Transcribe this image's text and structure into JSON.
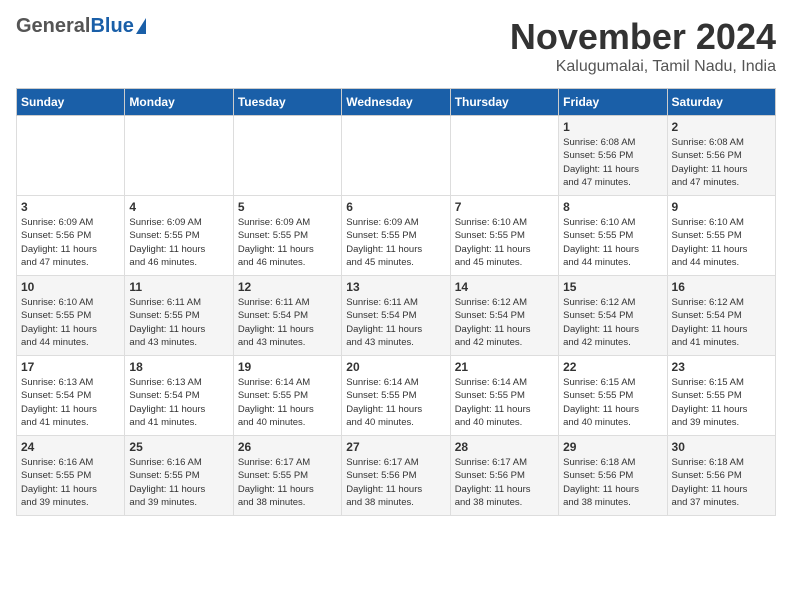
{
  "header": {
    "logo_general": "General",
    "logo_blue": "Blue",
    "month": "November 2024",
    "location": "Kalugumalai, Tamil Nadu, India"
  },
  "weekdays": [
    "Sunday",
    "Monday",
    "Tuesday",
    "Wednesday",
    "Thursday",
    "Friday",
    "Saturday"
  ],
  "weeks": [
    [
      {
        "day": "",
        "info": ""
      },
      {
        "day": "",
        "info": ""
      },
      {
        "day": "",
        "info": ""
      },
      {
        "day": "",
        "info": ""
      },
      {
        "day": "",
        "info": ""
      },
      {
        "day": "1",
        "info": "Sunrise: 6:08 AM\nSunset: 5:56 PM\nDaylight: 11 hours\nand 47 minutes."
      },
      {
        "day": "2",
        "info": "Sunrise: 6:08 AM\nSunset: 5:56 PM\nDaylight: 11 hours\nand 47 minutes."
      }
    ],
    [
      {
        "day": "3",
        "info": "Sunrise: 6:09 AM\nSunset: 5:56 PM\nDaylight: 11 hours\nand 47 minutes."
      },
      {
        "day": "4",
        "info": "Sunrise: 6:09 AM\nSunset: 5:55 PM\nDaylight: 11 hours\nand 46 minutes."
      },
      {
        "day": "5",
        "info": "Sunrise: 6:09 AM\nSunset: 5:55 PM\nDaylight: 11 hours\nand 46 minutes."
      },
      {
        "day": "6",
        "info": "Sunrise: 6:09 AM\nSunset: 5:55 PM\nDaylight: 11 hours\nand 45 minutes."
      },
      {
        "day": "7",
        "info": "Sunrise: 6:10 AM\nSunset: 5:55 PM\nDaylight: 11 hours\nand 45 minutes."
      },
      {
        "day": "8",
        "info": "Sunrise: 6:10 AM\nSunset: 5:55 PM\nDaylight: 11 hours\nand 44 minutes."
      },
      {
        "day": "9",
        "info": "Sunrise: 6:10 AM\nSunset: 5:55 PM\nDaylight: 11 hours\nand 44 minutes."
      }
    ],
    [
      {
        "day": "10",
        "info": "Sunrise: 6:10 AM\nSunset: 5:55 PM\nDaylight: 11 hours\nand 44 minutes."
      },
      {
        "day": "11",
        "info": "Sunrise: 6:11 AM\nSunset: 5:55 PM\nDaylight: 11 hours\nand 43 minutes."
      },
      {
        "day": "12",
        "info": "Sunrise: 6:11 AM\nSunset: 5:54 PM\nDaylight: 11 hours\nand 43 minutes."
      },
      {
        "day": "13",
        "info": "Sunrise: 6:11 AM\nSunset: 5:54 PM\nDaylight: 11 hours\nand 43 minutes."
      },
      {
        "day": "14",
        "info": "Sunrise: 6:12 AM\nSunset: 5:54 PM\nDaylight: 11 hours\nand 42 minutes."
      },
      {
        "day": "15",
        "info": "Sunrise: 6:12 AM\nSunset: 5:54 PM\nDaylight: 11 hours\nand 42 minutes."
      },
      {
        "day": "16",
        "info": "Sunrise: 6:12 AM\nSunset: 5:54 PM\nDaylight: 11 hours\nand 41 minutes."
      }
    ],
    [
      {
        "day": "17",
        "info": "Sunrise: 6:13 AM\nSunset: 5:54 PM\nDaylight: 11 hours\nand 41 minutes."
      },
      {
        "day": "18",
        "info": "Sunrise: 6:13 AM\nSunset: 5:54 PM\nDaylight: 11 hours\nand 41 minutes."
      },
      {
        "day": "19",
        "info": "Sunrise: 6:14 AM\nSunset: 5:55 PM\nDaylight: 11 hours\nand 40 minutes."
      },
      {
        "day": "20",
        "info": "Sunrise: 6:14 AM\nSunset: 5:55 PM\nDaylight: 11 hours\nand 40 minutes."
      },
      {
        "day": "21",
        "info": "Sunrise: 6:14 AM\nSunset: 5:55 PM\nDaylight: 11 hours\nand 40 minutes."
      },
      {
        "day": "22",
        "info": "Sunrise: 6:15 AM\nSunset: 5:55 PM\nDaylight: 11 hours\nand 40 minutes."
      },
      {
        "day": "23",
        "info": "Sunrise: 6:15 AM\nSunset: 5:55 PM\nDaylight: 11 hours\nand 39 minutes."
      }
    ],
    [
      {
        "day": "24",
        "info": "Sunrise: 6:16 AM\nSunset: 5:55 PM\nDaylight: 11 hours\nand 39 minutes."
      },
      {
        "day": "25",
        "info": "Sunrise: 6:16 AM\nSunset: 5:55 PM\nDaylight: 11 hours\nand 39 minutes."
      },
      {
        "day": "26",
        "info": "Sunrise: 6:17 AM\nSunset: 5:55 PM\nDaylight: 11 hours\nand 38 minutes."
      },
      {
        "day": "27",
        "info": "Sunrise: 6:17 AM\nSunset: 5:56 PM\nDaylight: 11 hours\nand 38 minutes."
      },
      {
        "day": "28",
        "info": "Sunrise: 6:17 AM\nSunset: 5:56 PM\nDaylight: 11 hours\nand 38 minutes."
      },
      {
        "day": "29",
        "info": "Sunrise: 6:18 AM\nSunset: 5:56 PM\nDaylight: 11 hours\nand 38 minutes."
      },
      {
        "day": "30",
        "info": "Sunrise: 6:18 AM\nSunset: 5:56 PM\nDaylight: 11 hours\nand 37 minutes."
      }
    ]
  ]
}
